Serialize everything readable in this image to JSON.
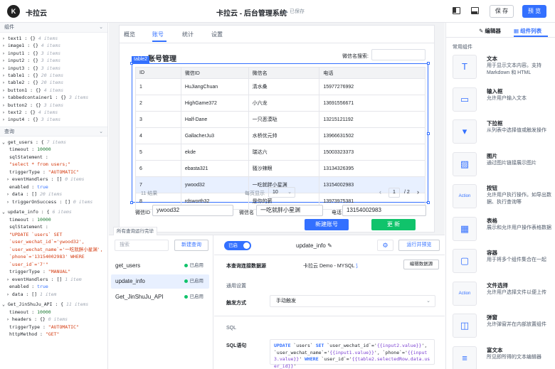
{
  "topbar": {
    "logo_text": "K",
    "brand": "卡拉云",
    "app_title": "卡拉云 - 后台管理系统",
    "saved_status": "已保存",
    "save_label": "保 存",
    "preview_label": "预 览"
  },
  "left_panel": {
    "components_header": "组件",
    "components": [
      {
        "name": "text1",
        "count": "4 items"
      },
      {
        "name": "image1",
        "count": "4 items"
      },
      {
        "name": "input1",
        "count": "3 items"
      },
      {
        "name": "input2",
        "count": "3 items"
      },
      {
        "name": "input3",
        "count": "3 items"
      },
      {
        "name": "table1",
        "count": "20 items"
      },
      {
        "name": "table2",
        "count": "20 items"
      },
      {
        "name": "button1",
        "count": "4 items"
      },
      {
        "name": "tabbedcontainer1",
        "count": "3 items"
      },
      {
        "name": "button2",
        "count": "3 items"
      },
      {
        "name": "text2",
        "count": "4 items"
      },
      {
        "name": "input4",
        "count": "3 items"
      }
    ],
    "queries_header": "查询"
  },
  "canvas": {
    "tabs": [
      "概览",
      "账号",
      "统计",
      "设置"
    ],
    "active_tab": "账号",
    "account_title": "账号管理",
    "search_label": "微信名搜索:",
    "table_tag": "table2",
    "table": {
      "columns": [
        "ID",
        "微信ID",
        "微信名",
        "电话"
      ],
      "rows": [
        [
          "1",
          "HuJiangChuan",
          "清水桑",
          "15977276992"
        ],
        [
          "2",
          "HighGame372",
          "小六龙",
          "13691556671"
        ],
        [
          "3",
          "Half-Dane",
          "一只恶漠哒",
          "13215121192"
        ],
        [
          "4",
          "GallacherJu3",
          "水桥优元帅",
          "13966631502"
        ],
        [
          "5",
          "ekde",
          "瑞达六",
          "15003323373"
        ],
        [
          "6",
          "ebasta321",
          "骚沙辣眼",
          "13134326395"
        ],
        [
          "7",
          "ywood32",
          "一吃就胖小星渊",
          "13154002983"
        ],
        [
          "8",
          "rdsworth32",
          "是你的薪",
          "13973975381"
        ]
      ],
      "selected_row": 7
    },
    "pager": {
      "total": "11 结果",
      "per_page_label": "每页显示",
      "per_page": "10",
      "current_page": "1",
      "total_pages": "/ 2"
    },
    "detail": {
      "wechat_id_label": "微信ID",
      "wechat_id_value": "ywood32",
      "wechat_name_label": "微信名",
      "wechat_name_value": "一吃就胖小星渊",
      "phone_label": "电话",
      "phone_value": "13154002983"
    },
    "new_account_label": "新建账号",
    "update_label": "更 新"
  },
  "query_panel": {
    "tag": "所有查询运行完毕",
    "search_placeholder": "搜索",
    "new_query_label": "新建查询",
    "queries": [
      {
        "name": "get_users",
        "status": "已启用"
      },
      {
        "name": "update_info",
        "status": "已启用"
      },
      {
        "name": "Get_JinShuJu_API",
        "status": "已启用"
      }
    ],
    "active_query": "update_info",
    "toggle_label": "已启",
    "query_name": "update_info",
    "run_label": "运行并预览",
    "datasource_label": "本查询连接数据源",
    "datasource_name": "卡拉云 Demo - MYSQL",
    "edit_datasource_label": "编辑数据源",
    "general_settings": "通用设置",
    "trigger_label": "触发方式",
    "trigger_value": "手动触发",
    "sql_header": "SQL",
    "sql_label": "SQL语句"
  },
  "right_panel": {
    "tab_editor": "编辑器",
    "tab_components": "组件列表",
    "common_label": "常用组件",
    "components": [
      {
        "name": "文本",
        "desc": "用于显示文本内容。支持 Markdown 和 HTML",
        "icon": "text-icon"
      },
      {
        "name": "输入框",
        "desc": "允许用户输入文本",
        "icon": "input-icon"
      },
      {
        "name": "下拉框",
        "desc": "从列表中选择值或触发操作",
        "icon": "select-icon"
      },
      {
        "name": "图片",
        "desc": "通过图片链接展示图片",
        "icon": "image-icon"
      },
      {
        "name": "按钮",
        "desc": "允许用户执行操作。如导出数据、执行查询等",
        "icon": "button-icon"
      },
      {
        "name": "表格",
        "desc": "展示和允许用户操作表格数据",
        "icon": "table-icon"
      },
      {
        "name": "容器",
        "desc": "用于将多个组件集合在一起",
        "icon": "container-icon"
      },
      {
        "name": "文件选择",
        "desc": "允许用户选择文件以便上传",
        "icon": "file-icon"
      },
      {
        "name": "弹窗",
        "desc": "允许弹窗并在内部放置组件",
        "icon": "modal-icon"
      },
      {
        "name": "富文本",
        "desc": "所见即所得的文本编辑器",
        "icon": "richtext-icon"
      }
    ]
  },
  "colors": {
    "accent": "#3370ff",
    "success": "#10c36b",
    "selected_row": "#e8f0ff"
  }
}
